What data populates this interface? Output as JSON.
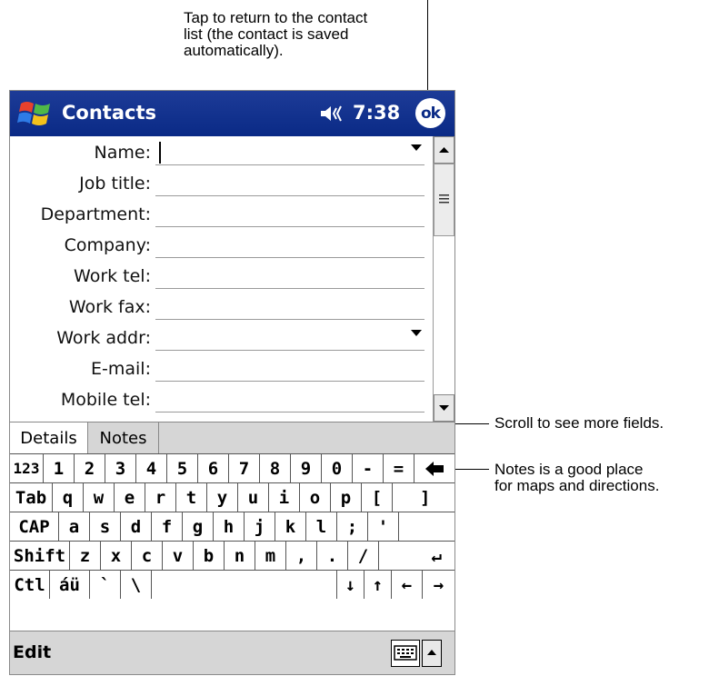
{
  "callouts": {
    "top": "Tap to return to the contact\nlist (the contact is saved\nautomatically).",
    "scroll": "Scroll to see more fields.",
    "notes": "Notes is a good place\nfor maps and directions."
  },
  "titlebar": {
    "title": "Contacts",
    "time": "7:38",
    "ok_label": "ok",
    "start_icon": "windows-flag-icon",
    "volume_icon": "speaker-icon",
    "color": "#0a2a86"
  },
  "form": {
    "fields": [
      {
        "label": "Name:",
        "value": "",
        "dropdown": true
      },
      {
        "label": "Job title:",
        "value": "",
        "dropdown": false
      },
      {
        "label": "Department:",
        "value": "",
        "dropdown": false
      },
      {
        "label": "Company:",
        "value": "",
        "dropdown": false
      },
      {
        "label": "Work tel:",
        "value": "",
        "dropdown": false
      },
      {
        "label": "Work fax:",
        "value": "",
        "dropdown": false
      },
      {
        "label": "Work addr:",
        "value": "",
        "dropdown": true
      },
      {
        "label": "E-mail:",
        "value": "",
        "dropdown": false
      },
      {
        "label": "Mobile tel:",
        "value": "",
        "dropdown": false
      }
    ]
  },
  "tabs": [
    {
      "label": "Details",
      "active": true
    },
    {
      "label": "Notes",
      "active": false
    }
  ],
  "keyboard": {
    "rows": [
      [
        "123",
        "1",
        "2",
        "3",
        "4",
        "5",
        "6",
        "7",
        "8",
        "9",
        "0",
        "-",
        "=",
        "◆"
      ],
      [
        "Tab",
        "q",
        "w",
        "e",
        "r",
        "t",
        "y",
        "u",
        "i",
        "o",
        "p",
        "[",
        "]"
      ],
      [
        "CAP",
        "a",
        "s",
        "d",
        "f",
        "g",
        "h",
        "j",
        "k",
        "l",
        ";",
        "'"
      ],
      [
        "Shift",
        "z",
        "x",
        "c",
        "v",
        "b",
        "n",
        "m",
        ",",
        ".",
        "/",
        "↵"
      ],
      [
        "Ctl",
        "áü",
        "`",
        "\\",
        "",
        "↓",
        "↑",
        "←",
        "→"
      ]
    ]
  },
  "menubar": {
    "edit_label": "Edit",
    "keyboard_icon": "keyboard-icon",
    "arrow_icon": "chevron-up-icon"
  }
}
